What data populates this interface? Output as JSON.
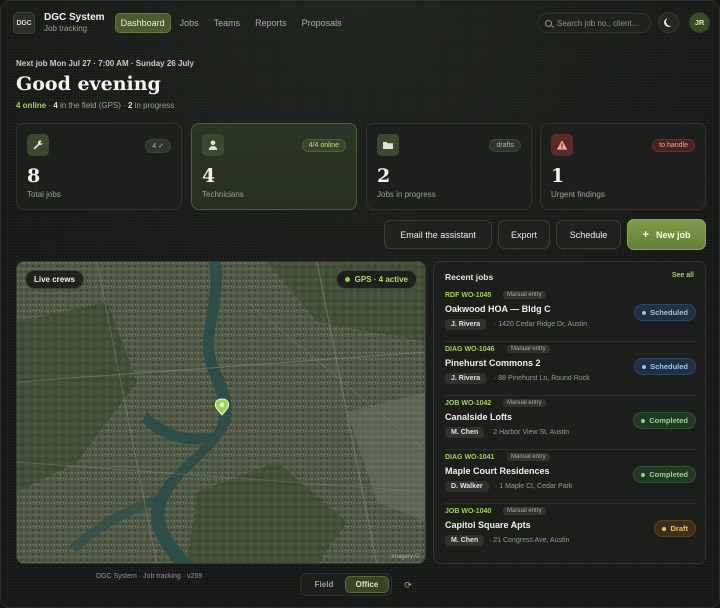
{
  "app": {
    "logo": "DGC",
    "name": "DGC System",
    "subtitle": "Job tracking",
    "user_initials": "JR"
  },
  "nav": {
    "items": [
      {
        "label": "Dashboard",
        "active": true
      },
      {
        "label": "Jobs",
        "active": false
      },
      {
        "label": "Teams",
        "active": false
      },
      {
        "label": "Reports",
        "active": false
      },
      {
        "label": "Proposals",
        "active": false
      }
    ]
  },
  "search": {
    "placeholder": "Search job no., client..."
  },
  "header": {
    "next_job": "Next job Mon Jul 27 · 7:00 AM · Sunday 26 July",
    "greeting": "Good evening",
    "status": {
      "online": "4 online",
      "sep1": " · ",
      "field_count": "4",
      "field_text": " in the field (GPS) · ",
      "progress_count": "2",
      "progress_text": " in progress"
    }
  },
  "stats": [
    {
      "icon": "wrench-icon",
      "badge": "4 ✓",
      "value": "8",
      "label": "Total jobs"
    },
    {
      "icon": "person-icon",
      "badge": "4/4 online",
      "value": "4",
      "label": "Technicians"
    },
    {
      "icon": "folder-icon",
      "badge": "drafts",
      "value": "2",
      "label": "Jobs in progress"
    },
    {
      "icon": "warning-icon",
      "badge": "to handle",
      "value": "1",
      "label": "Urgent findings"
    }
  ],
  "actions": {
    "email": "Email the assistant",
    "export": "Export",
    "schedule": "Schedule",
    "new_job": "New job",
    "new_job_plus": "+"
  },
  "map": {
    "live_label": "Live crews",
    "gps_label": "GPS · 4 active",
    "attribution": "Imagery ©"
  },
  "recent_jobs": {
    "title": "Recent jobs",
    "see_all": "See all",
    "items": [
      {
        "code": "RDF WO-1045",
        "tag": "Manual entry",
        "name": "Oakwood HOA — Bldg C",
        "tech": "J. Rivera",
        "address": "· 1420 Cedar Ridge Dr, Austin",
        "status": "Scheduled",
        "status_kind": "scheduled"
      },
      {
        "code": "DIAG WO-1046",
        "tag": "Manual entry",
        "name": "Pinehurst Commons 2",
        "tech": "J. Rivera",
        "address": "· 88 Pinehurst Ln, Round Rock",
        "status": "Scheduled",
        "status_kind": "scheduled"
      },
      {
        "code": "JOB WO-1042",
        "tag": "Manual entry",
        "name": "Canalside Lofts",
        "tech": "M. Chen",
        "address": "· 2 Harbor View St, Austin",
        "status": "Completed",
        "status_kind": "completed"
      },
      {
        "code": "DIAG WO-1041",
        "tag": "Manual entry",
        "name": "Maple Court Residences",
        "tech": "D. Walker",
        "address": "· 1 Maple Ct, Cedar Park",
        "status": "Completed",
        "status_kind": "completed"
      },
      {
        "code": "JOB WO-1040",
        "tag": "Manual entry",
        "name": "Capitol Square Apts",
        "tech": "M. Chen",
        "address": "· 21 Congress Ave, Austin",
        "status": "Draft",
        "status_kind": "draft"
      }
    ]
  },
  "footer": {
    "text": "DGC System · Job tracking · v259",
    "mode_field": "Field",
    "mode_office": "Office",
    "refresh_icon": "⟳"
  },
  "colors": {
    "accent": "#a7cf60",
    "scheduled": "#9cc3e8",
    "completed": "#8fd48e",
    "draft": "#e8c06c"
  }
}
